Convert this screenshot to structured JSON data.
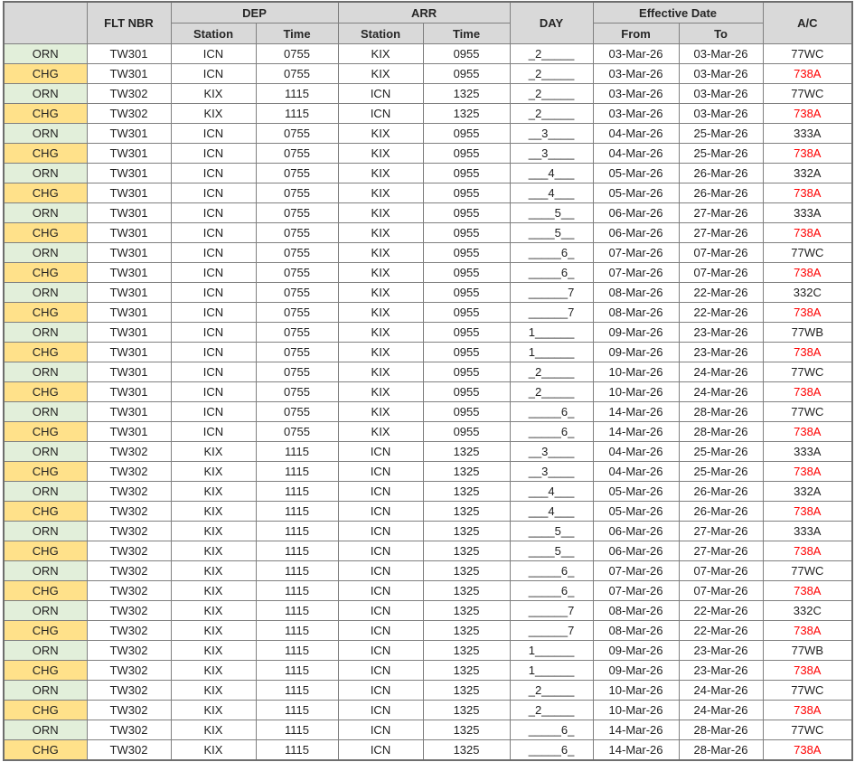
{
  "table": {
    "headers": {
      "corner": "",
      "flt_nbr": "FLT NBR",
      "dep": "DEP",
      "arr": "ARR",
      "day": "DAY",
      "effective_date": "Effective Date",
      "dep_station": "Station",
      "dep_time": "Time",
      "arr_station": "Station",
      "arr_time": "Time",
      "from": "From",
      "to": "To",
      "ac": "A/C"
    },
    "colors": {
      "header_bg": "#d9d9d9",
      "orn_bg": "#e2efda",
      "chg_bg": "#ffe18a",
      "border": "#808080",
      "chg_ac_text": "#ff0000",
      "text": "#1f1f1f"
    },
    "rows": [
      {
        "type": "ORN",
        "flt": "TW301",
        "dep_station": "ICN",
        "dep_time": "0755",
        "arr_station": "KIX",
        "arr_time": "0955",
        "day": "_2_____",
        "from": "03-Mar-26",
        "to": "03-Mar-26",
        "ac": "77WC"
      },
      {
        "type": "CHG",
        "flt": "TW301",
        "dep_station": "ICN",
        "dep_time": "0755",
        "arr_station": "KIX",
        "arr_time": "0955",
        "day": "_2_____",
        "from": "03-Mar-26",
        "to": "03-Mar-26",
        "ac": "738A"
      },
      {
        "type": "ORN",
        "flt": "TW302",
        "dep_station": "KIX",
        "dep_time": "1115",
        "arr_station": "ICN",
        "arr_time": "1325",
        "day": "_2_____",
        "from": "03-Mar-26",
        "to": "03-Mar-26",
        "ac": "77WC"
      },
      {
        "type": "CHG",
        "flt": "TW302",
        "dep_station": "KIX",
        "dep_time": "1115",
        "arr_station": "ICN",
        "arr_time": "1325",
        "day": "_2_____",
        "from": "03-Mar-26",
        "to": "03-Mar-26",
        "ac": "738A"
      },
      {
        "type": "ORN",
        "flt": "TW301",
        "dep_station": "ICN",
        "dep_time": "0755",
        "arr_station": "KIX",
        "arr_time": "0955",
        "day": "__3____",
        "from": "04-Mar-26",
        "to": "25-Mar-26",
        "ac": "333A"
      },
      {
        "type": "CHG",
        "flt": "TW301",
        "dep_station": "ICN",
        "dep_time": "0755",
        "arr_station": "KIX",
        "arr_time": "0955",
        "day": "__3____",
        "from": "04-Mar-26",
        "to": "25-Mar-26",
        "ac": "738A"
      },
      {
        "type": "ORN",
        "flt": "TW301",
        "dep_station": "ICN",
        "dep_time": "0755",
        "arr_station": "KIX",
        "arr_time": "0955",
        "day": "___4___",
        "from": "05-Mar-26",
        "to": "26-Mar-26",
        "ac": "332A"
      },
      {
        "type": "CHG",
        "flt": "TW301",
        "dep_station": "ICN",
        "dep_time": "0755",
        "arr_station": "KIX",
        "arr_time": "0955",
        "day": "___4___",
        "from": "05-Mar-26",
        "to": "26-Mar-26",
        "ac": "738A"
      },
      {
        "type": "ORN",
        "flt": "TW301",
        "dep_station": "ICN",
        "dep_time": "0755",
        "arr_station": "KIX",
        "arr_time": "0955",
        "day": "____5__",
        "from": "06-Mar-26",
        "to": "27-Mar-26",
        "ac": "333A"
      },
      {
        "type": "CHG",
        "flt": "TW301",
        "dep_station": "ICN",
        "dep_time": "0755",
        "arr_station": "KIX",
        "arr_time": "0955",
        "day": "____5__",
        "from": "06-Mar-26",
        "to": "27-Mar-26",
        "ac": "738A"
      },
      {
        "type": "ORN",
        "flt": "TW301",
        "dep_station": "ICN",
        "dep_time": "0755",
        "arr_station": "KIX",
        "arr_time": "0955",
        "day": "_____6_",
        "from": "07-Mar-26",
        "to": "07-Mar-26",
        "ac": "77WC"
      },
      {
        "type": "CHG",
        "flt": "TW301",
        "dep_station": "ICN",
        "dep_time": "0755",
        "arr_station": "KIX",
        "arr_time": "0955",
        "day": "_____6_",
        "from": "07-Mar-26",
        "to": "07-Mar-26",
        "ac": "738A"
      },
      {
        "type": "ORN",
        "flt": "TW301",
        "dep_station": "ICN",
        "dep_time": "0755",
        "arr_station": "KIX",
        "arr_time": "0955",
        "day": "______7",
        "from": "08-Mar-26",
        "to": "22-Mar-26",
        "ac": "332C"
      },
      {
        "type": "CHG",
        "flt": "TW301",
        "dep_station": "ICN",
        "dep_time": "0755",
        "arr_station": "KIX",
        "arr_time": "0955",
        "day": "______7",
        "from": "08-Mar-26",
        "to": "22-Mar-26",
        "ac": "738A"
      },
      {
        "type": "ORN",
        "flt": "TW301",
        "dep_station": "ICN",
        "dep_time": "0755",
        "arr_station": "KIX",
        "arr_time": "0955",
        "day": "1______",
        "from": "09-Mar-26",
        "to": "23-Mar-26",
        "ac": "77WB"
      },
      {
        "type": "CHG",
        "flt": "TW301",
        "dep_station": "ICN",
        "dep_time": "0755",
        "arr_station": "KIX",
        "arr_time": "0955",
        "day": "1______",
        "from": "09-Mar-26",
        "to": "23-Mar-26",
        "ac": "738A"
      },
      {
        "type": "ORN",
        "flt": "TW301",
        "dep_station": "ICN",
        "dep_time": "0755",
        "arr_station": "KIX",
        "arr_time": "0955",
        "day": "_2_____",
        "from": "10-Mar-26",
        "to": "24-Mar-26",
        "ac": "77WC"
      },
      {
        "type": "CHG",
        "flt": "TW301",
        "dep_station": "ICN",
        "dep_time": "0755",
        "arr_station": "KIX",
        "arr_time": "0955",
        "day": "_2_____",
        "from": "10-Mar-26",
        "to": "24-Mar-26",
        "ac": "738A"
      },
      {
        "type": "ORN",
        "flt": "TW301",
        "dep_station": "ICN",
        "dep_time": "0755",
        "arr_station": "KIX",
        "arr_time": "0955",
        "day": "_____6_",
        "from": "14-Mar-26",
        "to": "28-Mar-26",
        "ac": "77WC"
      },
      {
        "type": "CHG",
        "flt": "TW301",
        "dep_station": "ICN",
        "dep_time": "0755",
        "arr_station": "KIX",
        "arr_time": "0955",
        "day": "_____6_",
        "from": "14-Mar-26",
        "to": "28-Mar-26",
        "ac": "738A"
      },
      {
        "type": "ORN",
        "flt": "TW302",
        "dep_station": "KIX",
        "dep_time": "1115",
        "arr_station": "ICN",
        "arr_time": "1325",
        "day": "__3____",
        "from": "04-Mar-26",
        "to": "25-Mar-26",
        "ac": "333A"
      },
      {
        "type": "CHG",
        "flt": "TW302",
        "dep_station": "KIX",
        "dep_time": "1115",
        "arr_station": "ICN",
        "arr_time": "1325",
        "day": "__3____",
        "from": "04-Mar-26",
        "to": "25-Mar-26",
        "ac": "738A"
      },
      {
        "type": "ORN",
        "flt": "TW302",
        "dep_station": "KIX",
        "dep_time": "1115",
        "arr_station": "ICN",
        "arr_time": "1325",
        "day": "___4___",
        "from": "05-Mar-26",
        "to": "26-Mar-26",
        "ac": "332A"
      },
      {
        "type": "CHG",
        "flt": "TW302",
        "dep_station": "KIX",
        "dep_time": "1115",
        "arr_station": "ICN",
        "arr_time": "1325",
        "day": "___4___",
        "from": "05-Mar-26",
        "to": "26-Mar-26",
        "ac": "738A"
      },
      {
        "type": "ORN",
        "flt": "TW302",
        "dep_station": "KIX",
        "dep_time": "1115",
        "arr_station": "ICN",
        "arr_time": "1325",
        "day": "____5__",
        "from": "06-Mar-26",
        "to": "27-Mar-26",
        "ac": "333A"
      },
      {
        "type": "CHG",
        "flt": "TW302",
        "dep_station": "KIX",
        "dep_time": "1115",
        "arr_station": "ICN",
        "arr_time": "1325",
        "day": "____5__",
        "from": "06-Mar-26",
        "to": "27-Mar-26",
        "ac": "738A"
      },
      {
        "type": "ORN",
        "flt": "TW302",
        "dep_station": "KIX",
        "dep_time": "1115",
        "arr_station": "ICN",
        "arr_time": "1325",
        "day": "_____6_",
        "from": "07-Mar-26",
        "to": "07-Mar-26",
        "ac": "77WC"
      },
      {
        "type": "CHG",
        "flt": "TW302",
        "dep_station": "KIX",
        "dep_time": "1115",
        "arr_station": "ICN",
        "arr_time": "1325",
        "day": "_____6_",
        "from": "07-Mar-26",
        "to": "07-Mar-26",
        "ac": "738A"
      },
      {
        "type": "ORN",
        "flt": "TW302",
        "dep_station": "KIX",
        "dep_time": "1115",
        "arr_station": "ICN",
        "arr_time": "1325",
        "day": "______7",
        "from": "08-Mar-26",
        "to": "22-Mar-26",
        "ac": "332C"
      },
      {
        "type": "CHG",
        "flt": "TW302",
        "dep_station": "KIX",
        "dep_time": "1115",
        "arr_station": "ICN",
        "arr_time": "1325",
        "day": "______7",
        "from": "08-Mar-26",
        "to": "22-Mar-26",
        "ac": "738A"
      },
      {
        "type": "ORN",
        "flt": "TW302",
        "dep_station": "KIX",
        "dep_time": "1115",
        "arr_station": "ICN",
        "arr_time": "1325",
        "day": "1______",
        "from": "09-Mar-26",
        "to": "23-Mar-26",
        "ac": "77WB"
      },
      {
        "type": "CHG",
        "flt": "TW302",
        "dep_station": "KIX",
        "dep_time": "1115",
        "arr_station": "ICN",
        "arr_time": "1325",
        "day": "1______",
        "from": "09-Mar-26",
        "to": "23-Mar-26",
        "ac": "738A"
      },
      {
        "type": "ORN",
        "flt": "TW302",
        "dep_station": "KIX",
        "dep_time": "1115",
        "arr_station": "ICN",
        "arr_time": "1325",
        "day": "_2_____",
        "from": "10-Mar-26",
        "to": "24-Mar-26",
        "ac": "77WC"
      },
      {
        "type": "CHG",
        "flt": "TW302",
        "dep_station": "KIX",
        "dep_time": "1115",
        "arr_station": "ICN",
        "arr_time": "1325",
        "day": "_2_____",
        "from": "10-Mar-26",
        "to": "24-Mar-26",
        "ac": "738A"
      },
      {
        "type": "ORN",
        "flt": "TW302",
        "dep_station": "KIX",
        "dep_time": "1115",
        "arr_station": "ICN",
        "arr_time": "1325",
        "day": "_____6_",
        "from": "14-Mar-26",
        "to": "28-Mar-26",
        "ac": "77WC"
      },
      {
        "type": "CHG",
        "flt": "TW302",
        "dep_station": "KIX",
        "dep_time": "1115",
        "arr_station": "ICN",
        "arr_time": "1325",
        "day": "_____6_",
        "from": "14-Mar-26",
        "to": "28-Mar-26",
        "ac": "738A"
      }
    ]
  }
}
